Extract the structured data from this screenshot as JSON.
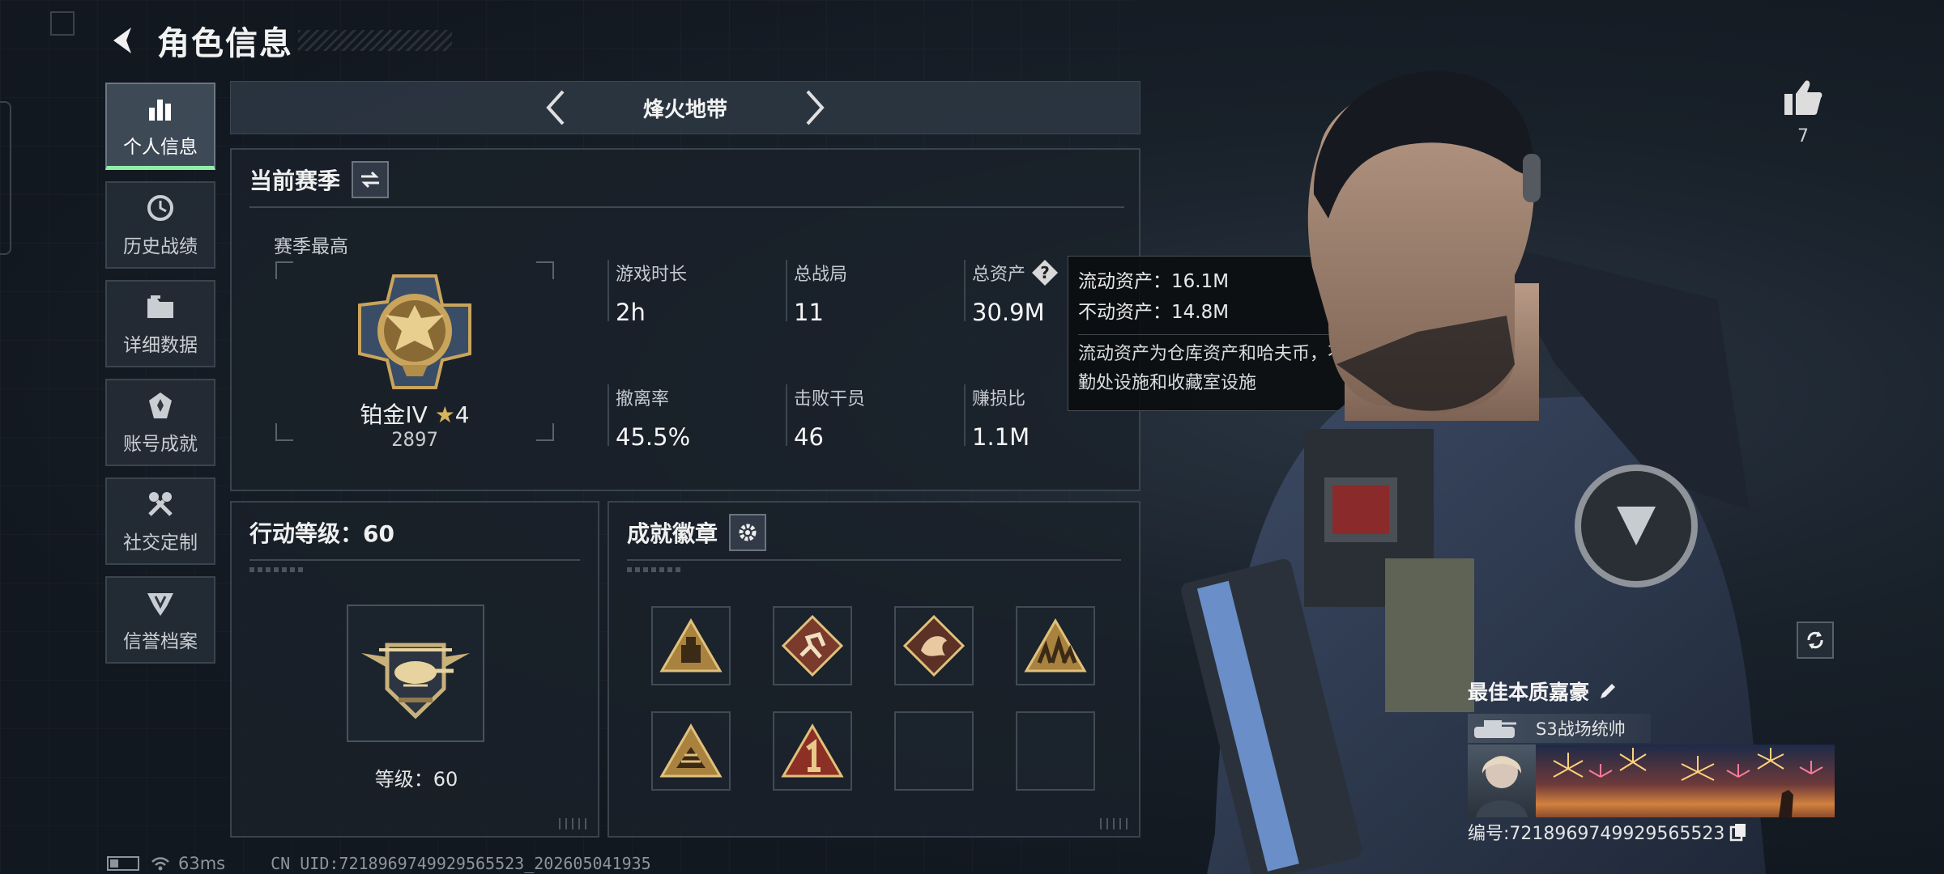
{
  "header": {
    "title": "角色信息"
  },
  "sidebar": {
    "items": [
      {
        "label": "个人信息",
        "active": true,
        "icon": "bar-chart-icon"
      },
      {
        "label": "历史战绩",
        "active": false,
        "icon": "history-clock-icon"
      },
      {
        "label": "详细数据",
        "active": false,
        "icon": "folder-icon"
      },
      {
        "label": "账号成就",
        "active": false,
        "icon": "achievement-icon"
      },
      {
        "label": "社交定制",
        "active": false,
        "icon": "tools-icon"
      },
      {
        "label": "信誉档案",
        "active": false,
        "icon": "shield-badge-icon"
      }
    ]
  },
  "mode": {
    "name": "烽火地带"
  },
  "season": {
    "title": "当前赛季",
    "best_label": "赛季最高",
    "rank_name": "铂金IV",
    "rank_stars": "4",
    "rank_score": "2897",
    "stats": [
      {
        "label": "游戏时长",
        "value": "2h"
      },
      {
        "label": "总战局",
        "value": "11"
      },
      {
        "label": "总资产",
        "value": "30.9M"
      },
      {
        "label": "撤离率",
        "value": "45.5%"
      },
      {
        "label": "击败干员",
        "value": "46"
      },
      {
        "label": "赚损比",
        "value": "1.1M"
      }
    ]
  },
  "tooltip": {
    "liquid": "流动资产：16.1M",
    "fixed": "不动资产：14.8M",
    "desc": "流动资产为仓库资产和哈夫币，不动资产为特勤处设施和收藏室设施"
  },
  "level": {
    "title": "行动等级：60",
    "level_text": "等级：60"
  },
  "achievements": {
    "title": "成就徽章",
    "badges_filled": 6,
    "badges_total": 8
  },
  "profile": {
    "likes": "7",
    "player_name": "最佳本质嘉豪",
    "title_text": "S3战场统帅",
    "player_id": "编号:7218969749929565523"
  },
  "footer": {
    "ping": "63ms",
    "uid": "CN UID:7218969749929565523_202605041935"
  },
  "colors": {
    "accent": "#8ef0a6",
    "gold": "#d8b25c",
    "panel": "#1a212a"
  }
}
